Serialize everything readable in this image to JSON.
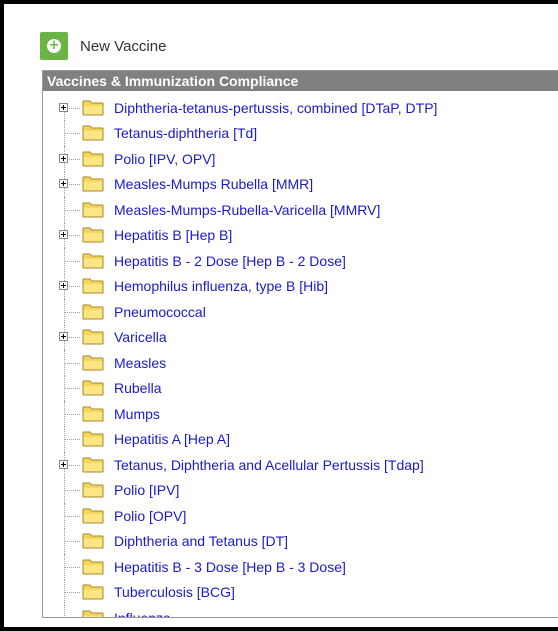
{
  "toolbar": {
    "new_label": "New Vaccine",
    "accent_color": "#6ab344"
  },
  "panel": {
    "title": "Vaccines & Immunization Compliance",
    "header_color": "#808080",
    "link_color": "#1a1acc",
    "folder_color": "#f5d65c"
  },
  "tree": {
    "items": [
      {
        "label": "Diphtheria-tetanus-pertussis, combined [DTaP, DTP]",
        "expandable": true
      },
      {
        "label": "Tetanus-diphtheria [Td]",
        "expandable": false
      },
      {
        "label": "Polio [IPV, OPV]",
        "expandable": true
      },
      {
        "label": "Measles-Mumps Rubella [MMR]",
        "expandable": true
      },
      {
        "label": "Measles-Mumps-Rubella-Varicella [MMRV]",
        "expandable": false
      },
      {
        "label": "Hepatitis B [Hep B]",
        "expandable": true
      },
      {
        "label": "Hepatitis B - 2 Dose [Hep B - 2 Dose]",
        "expandable": false
      },
      {
        "label": "Hemophilus influenza, type B [Hib]",
        "expandable": true
      },
      {
        "label": "Pneumococcal",
        "expandable": false
      },
      {
        "label": "Varicella",
        "expandable": true
      },
      {
        "label": "Measles",
        "expandable": false
      },
      {
        "label": "Rubella",
        "expandable": false
      },
      {
        "label": "Mumps",
        "expandable": false
      },
      {
        "label": "Hepatitis A [Hep A]",
        "expandable": false
      },
      {
        "label": "Tetanus, Diphtheria and Acellular Pertussis [Tdap]",
        "expandable": true
      },
      {
        "label": "Polio [IPV]",
        "expandable": false
      },
      {
        "label": "Polio [OPV]",
        "expandable": false
      },
      {
        "label": "Diphtheria and Tetanus [DT]",
        "expandable": false
      },
      {
        "label": "Hepatitis B - 3 Dose [Hep B - 3 Dose]",
        "expandable": false
      },
      {
        "label": "Tuberculosis [BCG]",
        "expandable": false
      },
      {
        "label": "Influenza",
        "expandable": false
      }
    ]
  }
}
